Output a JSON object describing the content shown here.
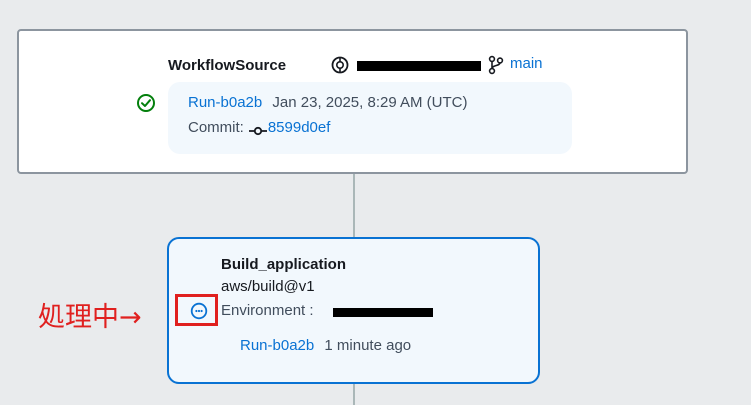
{
  "colors": {
    "link": "#0972d3",
    "success": "#037f0c",
    "in_progress": "#0972d3",
    "annotation": "#e0201f"
  },
  "source": {
    "title": "WorkflowSource",
    "repo_icon": "repo-icon",
    "branch_icon": "git-branch-icon",
    "branch": "main",
    "status_icon": "success-check-icon",
    "run_id": "Run-b0a2b",
    "run_time": "Jan 23, 2025, 8:29 AM (UTC)",
    "commit_label": "Commit:",
    "commit_icon": "git-commit-icon",
    "commit_hash": "8599d0ef"
  },
  "action": {
    "title": "Build_application",
    "subtitle": "aws/build@v1",
    "status_icon": "in-progress-icon",
    "environment_label": "Environment :",
    "run_id": "Run-b0a2b",
    "run_time": "1 minute ago"
  },
  "annotation": {
    "label": "処理中→"
  }
}
